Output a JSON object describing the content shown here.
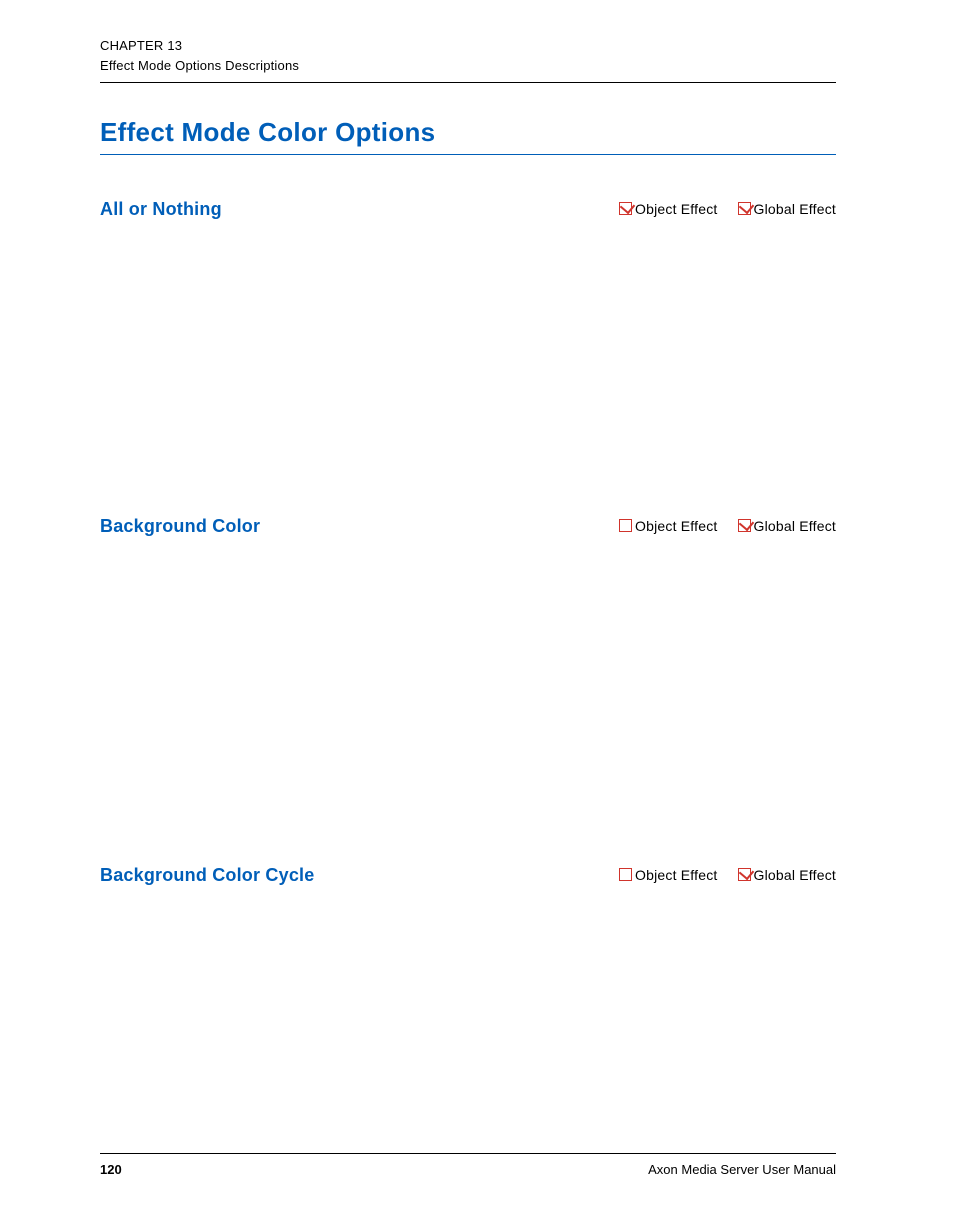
{
  "header": {
    "chapter_line": "CHAPTER 13",
    "subtitle_line": "Effect Mode Options Descriptions"
  },
  "section": {
    "title": "Effect Mode Color Options"
  },
  "subsections": [
    {
      "title": "All or Nothing",
      "flags": {
        "object_effect": {
          "label": "Object Effect",
          "checked": true
        },
        "global_effect": {
          "label": "Global Effect",
          "checked": true
        }
      }
    },
    {
      "title": "Background Color",
      "flags": {
        "object_effect": {
          "label": "Object Effect",
          "checked": false
        },
        "global_effect": {
          "label": "Global Effect",
          "checked": true
        }
      }
    },
    {
      "title": "Background Color Cycle",
      "flags": {
        "object_effect": {
          "label": "Object Effect",
          "checked": false
        },
        "global_effect": {
          "label": "Global Effect",
          "checked": true
        }
      }
    }
  ],
  "footer": {
    "page_number": "120",
    "manual_name": "Axon Media Server User Manual"
  }
}
